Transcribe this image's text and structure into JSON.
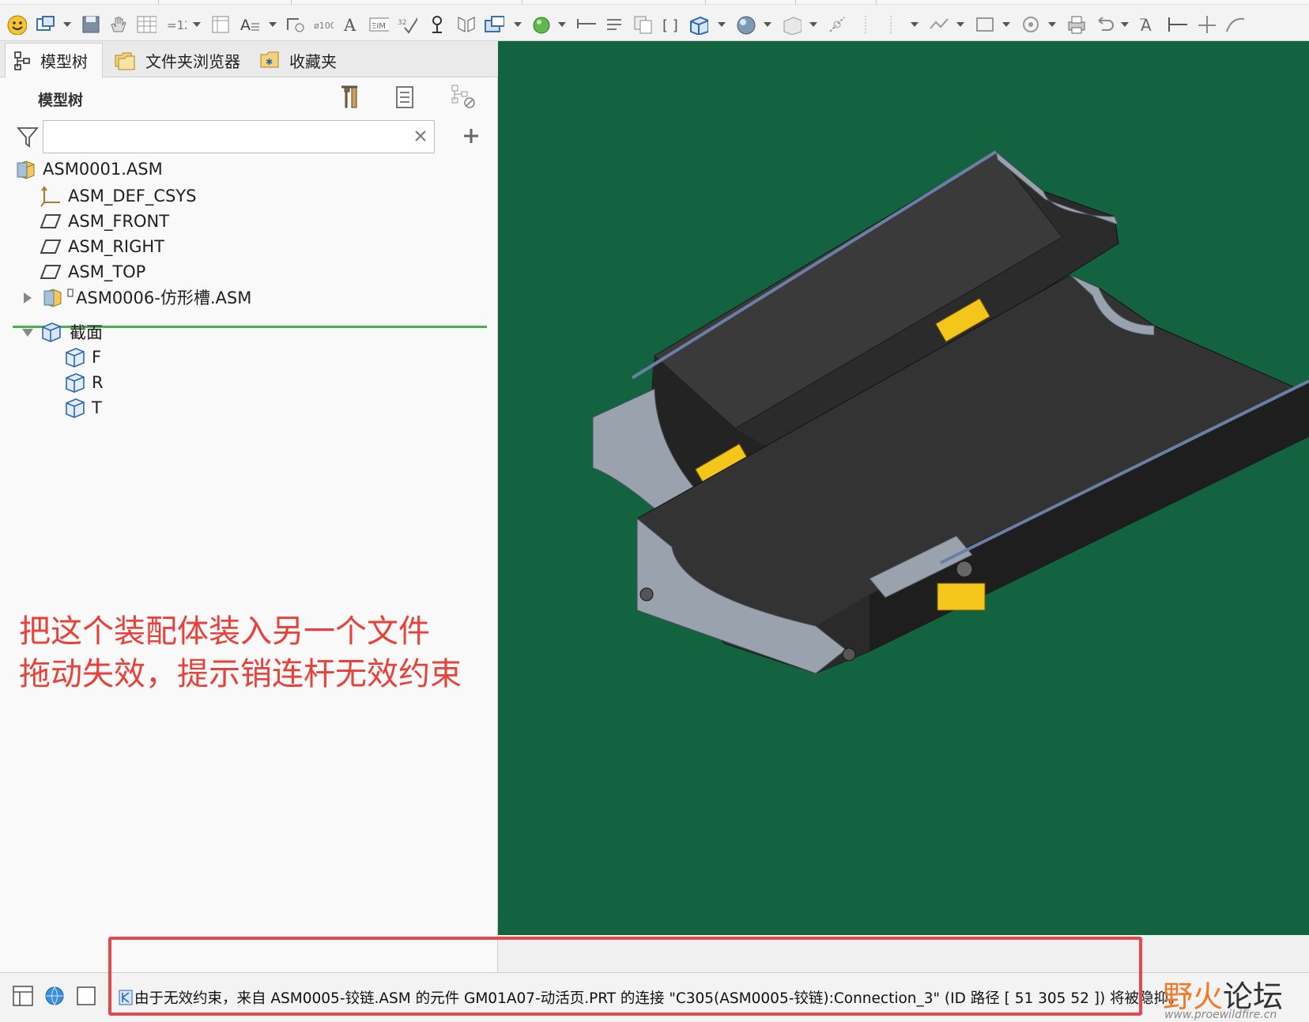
{
  "tabs": [
    {
      "label": "模型树",
      "icon": "model-tree-icon",
      "active": true
    },
    {
      "label": "文件夹浏览器",
      "icon": "folder-browser-icon",
      "active": false
    },
    {
      "label": "收藏夹",
      "icon": "favorites-icon",
      "active": false
    }
  ],
  "tree": {
    "title": "模型树",
    "filter_value": "",
    "root": "ASM0001.ASM",
    "features": [
      "ASM_DEF_CSYS",
      "ASM_FRONT",
      "ASM_RIGHT",
      "ASM_TOP"
    ],
    "subassembly": "ASM0006-仿形槽.ASM",
    "section_group": "截面",
    "sections": [
      "F",
      "R",
      "T"
    ]
  },
  "annotation": {
    "line1": "把这个装配体装入另一个文件",
    "line2": "拖动失效，提示销连杆无效约束"
  },
  "status": {
    "message": "由于无效约束，来自 ASM0005-铰链.ASM 的元件 GM01A07-动活页.PRT 的连接 \"C305(ASM0005-铰链):Connection_3\" (ID 路径 [ 51 305 52 ]) 将被隐抑。"
  },
  "watermark": {
    "title_a": "野火",
    "title_b": "论坛",
    "url": "www.proewildfire.cn"
  },
  "colors": {
    "viewport_bg": "#136240",
    "annotation": "#e8413a",
    "highlight": "#e5484d",
    "divider": "#4caf50"
  }
}
